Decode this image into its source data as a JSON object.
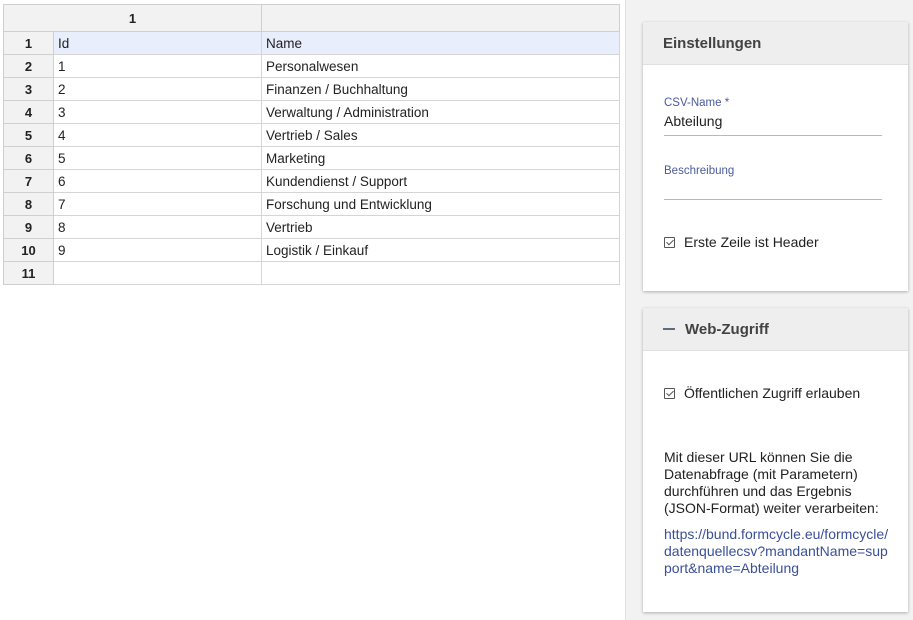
{
  "sheet": {
    "column_headers": [
      "1",
      ""
    ],
    "row_numbers": [
      "1",
      "2",
      "3",
      "4",
      "5",
      "6",
      "7",
      "8",
      "9",
      "10",
      "11"
    ],
    "rows": [
      [
        "Id",
        "Name"
      ],
      [
        "1",
        "Personalwesen"
      ],
      [
        "2",
        "Finanzen / Buchhaltung"
      ],
      [
        "3",
        "Verwaltung / Administration"
      ],
      [
        "4",
        "Vertrieb / Sales"
      ],
      [
        "5",
        "Marketing"
      ],
      [
        "6",
        "Kundendienst / Support"
      ],
      [
        "7",
        "Forschung und Entwicklung"
      ],
      [
        "8",
        "Vertrieb"
      ],
      [
        "9",
        "Logistik / Einkauf"
      ],
      [
        "",
        ""
      ]
    ]
  },
  "settings": {
    "title": "Einstellungen",
    "csv_name_label": "CSV-Name *",
    "csv_name_value": "Abteilung",
    "description_label": "Beschreibung",
    "description_value": "",
    "header_checkbox_label": "Erste Zeile ist Header",
    "header_checkbox_checked": true
  },
  "web_access": {
    "title": "Web-Zugriff",
    "public_checkbox_label": "Öffentlichen Zugriff erlauben",
    "public_checkbox_checked": true,
    "info_text": "Mit dieser URL können Sie die Datenabfrage (mit Parametern) durchführen und das Ergebnis (JSON-Format) weiter verarbeiten:",
    "url": "https://bund.formcycle.eu/formcycle/datenquellecsv?mandantName=support&name=Abteilung"
  },
  "colors": {
    "header_row_highlight": "#e8eefb",
    "label_blue": "#4a5b9b",
    "link_blue": "#3a4f9a",
    "panel_bg": "#f2f2f2"
  },
  "icons": {
    "checkbox": "checkbox-checked-icon",
    "collapse": "minus-icon"
  }
}
